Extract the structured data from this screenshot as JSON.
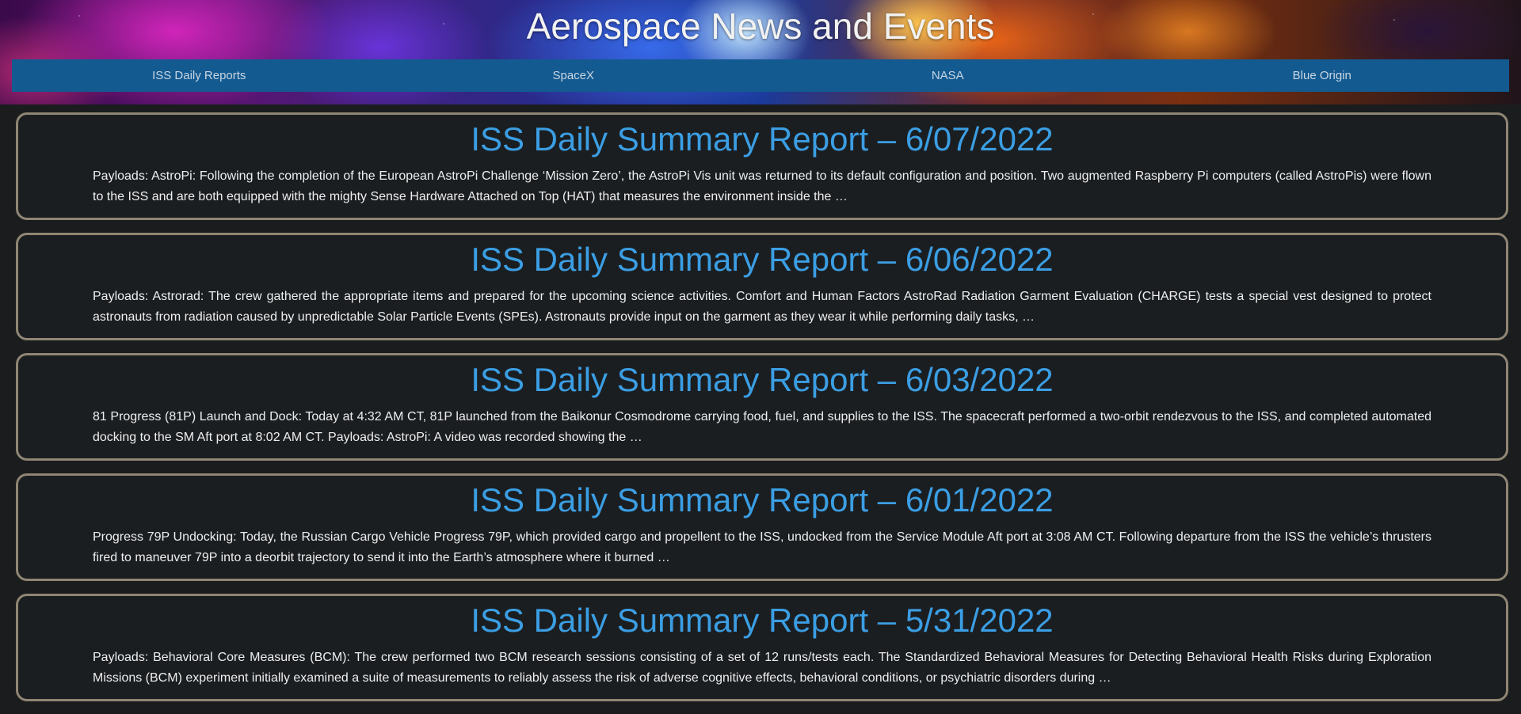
{
  "header": {
    "title": "Aerospace News and Events"
  },
  "nav": {
    "items": [
      {
        "label": "ISS Daily Reports"
      },
      {
        "label": "SpaceX"
      },
      {
        "label": "NASA"
      },
      {
        "label": "Blue Origin"
      }
    ]
  },
  "posts": [
    {
      "title": "ISS Daily Summary Report – 6/07/2022",
      "excerpt": "Payloads: AstroPi: Following the completion of the European AstroPi Challenge ‘Mission Zero’, the AstroPi Vis unit was returned to its default configuration and position. Two augmented Raspberry Pi computers (called AstroPis) were flown to the ISS and are both equipped with the mighty Sense Hardware Attached on Top (HAT) that measures the environment inside the …"
    },
    {
      "title": "ISS Daily Summary Report – 6/06/2022",
      "excerpt": "Payloads: Astrorad: The crew gathered the appropriate items and prepared for the upcoming science activities.  Comfort and Human Factors AstroRad Radiation Garment Evaluation (CHARGE) tests a special vest designed to protect astronauts from radiation caused by unpredictable Solar Particle Events (SPEs). Astronauts provide input on the garment as they wear it while performing daily tasks, …"
    },
    {
      "title": "ISS Daily Summary Report – 6/03/2022",
      "excerpt": "81 Progress (81P) Launch and Dock: Today at 4:32 AM CT, 81P launched from the Baikonur Cosmodrome carrying food, fuel, and supplies to the ISS. The spacecraft performed a two-orbit rendezvous to the ISS, and completed automated docking to the SM Aft port at 8:02 AM CT. Payloads: AstroPi: A video was recorded showing the …"
    },
    {
      "title": "ISS Daily Summary Report – 6/01/2022",
      "excerpt": "Progress 79P Undocking: Today, the Russian Cargo Vehicle Progress 79P, which provided cargo and propellent to the ISS, undocked from the Service Module Aft port at 3:08 AM CT. Following departure from the ISS the vehicle’s thrusters fired to maneuver 79P into a deorbit trajectory to send it into the Earth’s atmosphere where it burned …"
    },
    {
      "title": "ISS Daily Summary Report – 5/31/2022",
      "excerpt": "Payloads: Behavioral Core Measures (BCM): The crew performed two BCM research sessions consisting of a set of 12 runs/tests each. The Standardized Behavioral Measures for Detecting Behavioral Health Risks during Exploration Missions (BCM) experiment initially examined a suite of measurements to reliably assess the risk of adverse cognitive effects, behavioral conditions, or psychiatric disorders during …"
    }
  ],
  "colors": {
    "page_background": "#1a1c1e",
    "nav_background": "#135a91",
    "title_link": "#3b9ee3",
    "card_border": "#8f8673",
    "body_text": "#eeeeee"
  }
}
